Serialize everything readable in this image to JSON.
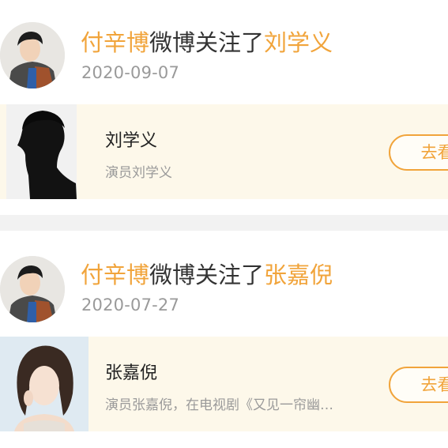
{
  "feed": [
    {
      "user": "付辛博",
      "action": "微博关注了",
      "target": "刘学义",
      "date": "2020-09-07",
      "card": {
        "name": "刘学义",
        "description": "演员刘学义",
        "button_label": "去看看"
      }
    },
    {
      "user": "付辛博",
      "action": "微博关注了",
      "target": "张嘉倪",
      "date": "2020-07-27",
      "card": {
        "name": "张嘉倪",
        "description": "演员张嘉倪，在电视剧《又见一帘幽…",
        "button_label": "去看看"
      }
    }
  ],
  "colors": {
    "accent": "#f1a43b",
    "card_background": "#fdf8ea",
    "divider": "#f2f2f2",
    "muted_text": "#9a9a9a"
  }
}
